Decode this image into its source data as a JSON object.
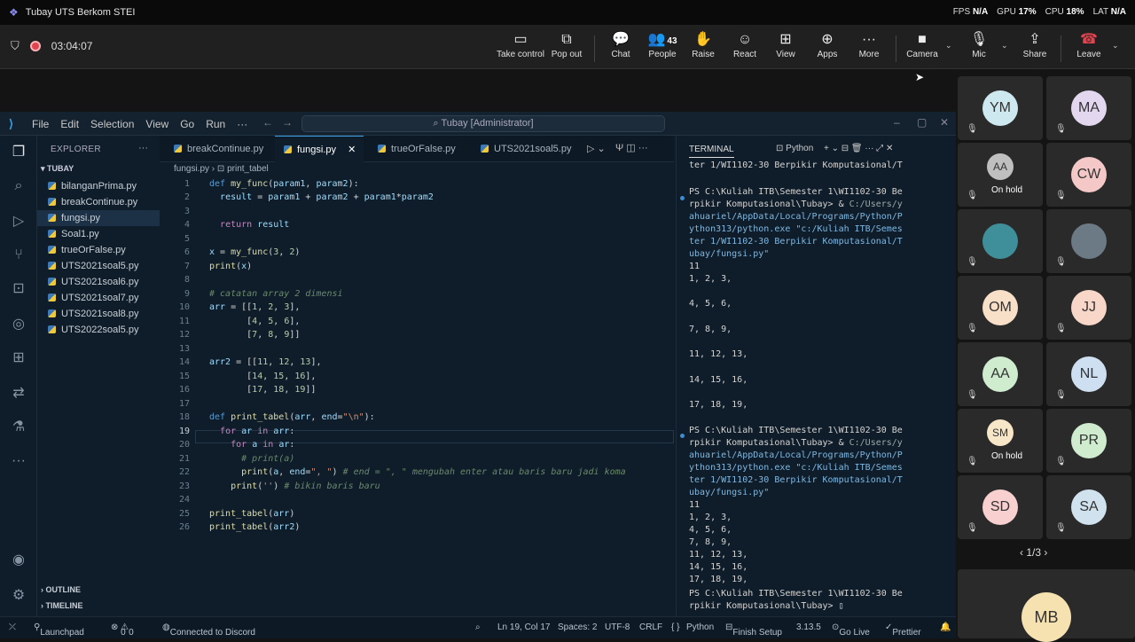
{
  "titlebar": {
    "app": "Tubay UTS Berkom STEI",
    "fps_label": "FPS",
    "fps": "N/A",
    "gpu_label": "GPU",
    "gpu": "17%",
    "cpu_label": "CPU",
    "cpu": "18%",
    "lat_label": "LAT",
    "lat": "N/A"
  },
  "meeting": {
    "timer": "03:04:07",
    "buttons": {
      "take_control": "Take control",
      "pop_out": "Pop out",
      "chat": "Chat",
      "people": "People",
      "people_count": "43",
      "raise": "Raise",
      "react": "React",
      "view": "View",
      "apps": "Apps",
      "more": "More",
      "camera": "Camera",
      "mic": "Mic",
      "share": "Share",
      "leave": "Leave"
    }
  },
  "vscode": {
    "menu": [
      "File",
      "Edit",
      "Selection",
      "View",
      "Go",
      "Run",
      "···"
    ],
    "search": "Tubay [Administrator]",
    "explorer": {
      "header": "EXPLORER",
      "folder": "TUBAY",
      "files": [
        "bilanganPrima.py",
        "breakContinue.py",
        "fungsi.py",
        "Soal1.py",
        "trueOrFalse.py",
        "UTS2021soal5.py",
        "UTS2021soal6.py",
        "UTS2021soal7.py",
        "UTS2021soal8.py",
        "UTS2022soal5.py"
      ],
      "outline": "OUTLINE",
      "timeline": "TIMELINE"
    },
    "tabs": [
      "breakContinue.py",
      "fungsi.py",
      "trueOrFalse.py",
      "UTS2021soal5.py"
    ],
    "breadcrumb": {
      "file": "fungsi.py",
      "symbol": "print_tabel"
    },
    "terminal": {
      "title": "TERMINAL",
      "shell": "Python"
    },
    "status": {
      "launchpad": "Launchpad",
      "problems": "0",
      "warnings": "0",
      "discord": "Connected to Discord",
      "position": "Ln 19, Col 17",
      "spaces": "Spaces: 2",
      "encoding": "UTF-8",
      "eol": "CRLF",
      "lang_mode": "{ }",
      "lang": "Python",
      "finish": "Finish Setup",
      "version": "3.13.5",
      "golive": "Go Live",
      "prettier": "Prettier"
    }
  },
  "participants": {
    "tiles": [
      {
        "initials": "YM",
        "color": "#cde8ee"
      },
      {
        "initials": "MA",
        "color": "#e3d6ef"
      },
      {
        "initials": "AA",
        "color": "#bfbfbf",
        "status": "On hold"
      },
      {
        "initials": "CW",
        "color": "#f5c8c8"
      },
      {
        "initials": "",
        "color": "#3f8f9a"
      },
      {
        "initials": "",
        "color": "#6c7a86"
      },
      {
        "initials": "OM",
        "color": "#f8e0c8"
      },
      {
        "initials": "JJ",
        "color": "#f8d6c8"
      },
      {
        "initials": "AA",
        "color": "#cfeccf"
      },
      {
        "initials": "NL",
        "color": "#cfdff2"
      },
      {
        "initials": "SM",
        "color": "#f8e6c8",
        "status": "On hold"
      },
      {
        "initials": "PR",
        "color": "#cfeccf"
      },
      {
        "initials": "SD",
        "color": "#f8d0d0"
      },
      {
        "initials": "SA",
        "color": "#cfe2ee"
      }
    ],
    "pager": "1/3",
    "bottom_initials": "MB"
  }
}
